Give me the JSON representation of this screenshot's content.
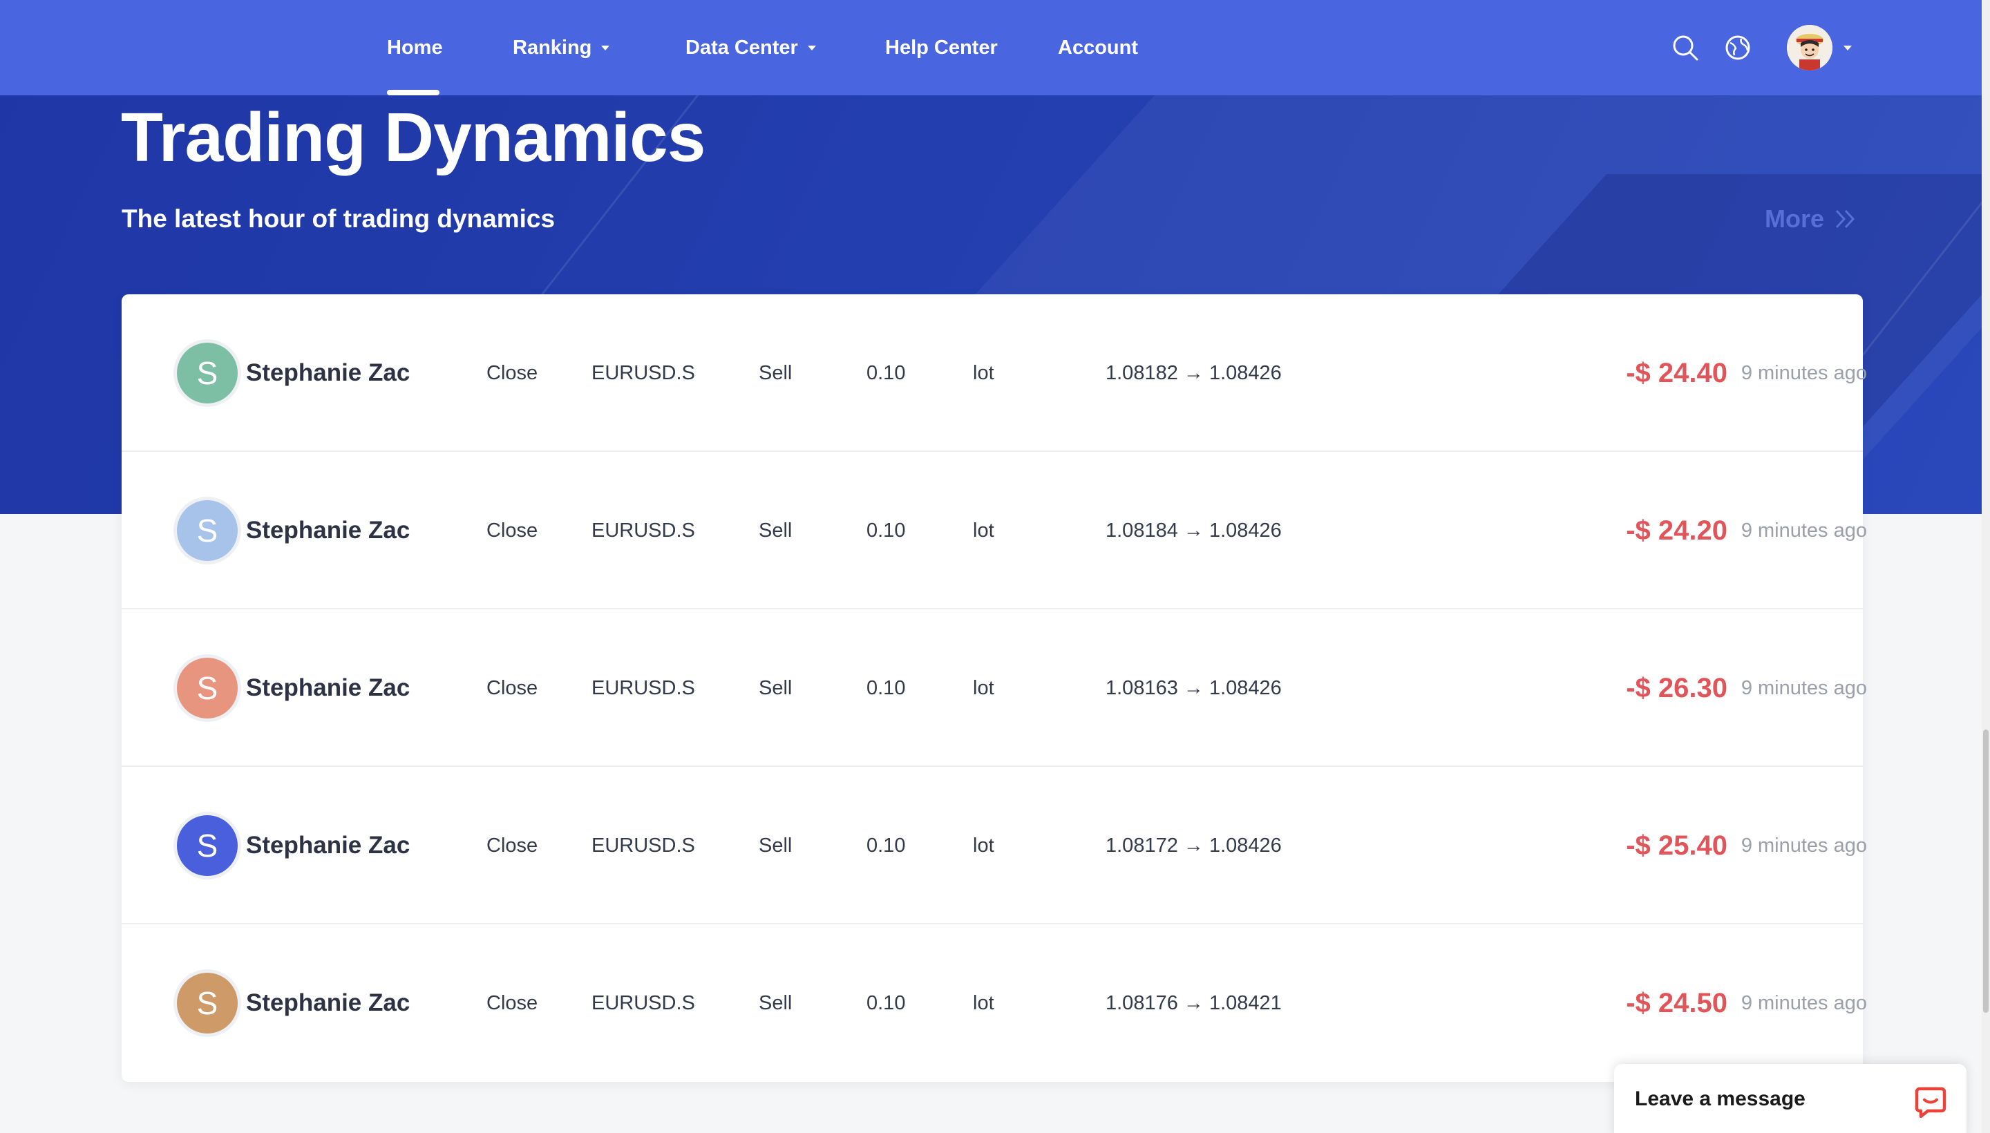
{
  "nav": {
    "items": [
      {
        "label": "Home",
        "active": true,
        "dropdown": false
      },
      {
        "label": "Ranking",
        "active": false,
        "dropdown": true
      },
      {
        "label": "Data Center",
        "active": false,
        "dropdown": true
      },
      {
        "label": "Help Center",
        "active": false,
        "dropdown": false
      },
      {
        "label": "Account",
        "active": false,
        "dropdown": false
      }
    ],
    "icons": [
      "search-icon",
      "globe-icon",
      "user-avatar"
    ]
  },
  "hero": {
    "title": "Trading Dynamics",
    "subtitle": "The latest hour of trading dynamics",
    "more_label": "More"
  },
  "trades": [
    {
      "initial": "S",
      "avatar_color": "#7dbfa5",
      "name": "Stephanie Zac",
      "action": "Close",
      "symbol": "EURUSD.S",
      "side": "Sell",
      "volume": "0.10",
      "unit": "lot",
      "price": "1.08182 → 1.08426",
      "profit": "-$ 24.40",
      "time": "9 minutes ago"
    },
    {
      "initial": "S",
      "avatar_color": "#a7c3ea",
      "name": "Stephanie Zac",
      "action": "Close",
      "symbol": "EURUSD.S",
      "side": "Sell",
      "volume": "0.10",
      "unit": "lot",
      "price": "1.08184 → 1.08426",
      "profit": "-$ 24.20",
      "time": "9 minutes ago"
    },
    {
      "initial": "S",
      "avatar_color": "#e89580",
      "name": "Stephanie Zac",
      "action": "Close",
      "symbol": "EURUSD.S",
      "side": "Sell",
      "volume": "0.10",
      "unit": "lot",
      "price": "1.08163 → 1.08426",
      "profit": "-$ 26.30",
      "time": "9 minutes ago"
    },
    {
      "initial": "S",
      "avatar_color": "#4a5fdc",
      "name": "Stephanie Zac",
      "action": "Close",
      "symbol": "EURUSD.S",
      "side": "Sell",
      "volume": "0.10",
      "unit": "lot",
      "price": "1.08172 → 1.08426",
      "profit": "-$ 25.40",
      "time": "9 minutes ago"
    },
    {
      "initial": "S",
      "avatar_color": "#cd9a68",
      "name": "Stephanie Zac",
      "action": "Close",
      "symbol": "EURUSD.S",
      "side": "Sell",
      "volume": "0.10",
      "unit": "lot",
      "price": "1.08176 → 1.08421",
      "profit": "-$ 24.50",
      "time": "9 minutes ago"
    }
  ],
  "chat": {
    "label": "Leave a message",
    "icon": "chat-bubble-icon",
    "accent": "#e8443a"
  },
  "colors": {
    "nav_bg": "#4a65e0",
    "hero_bg": "#2440b0",
    "loss": "#e0555a"
  }
}
